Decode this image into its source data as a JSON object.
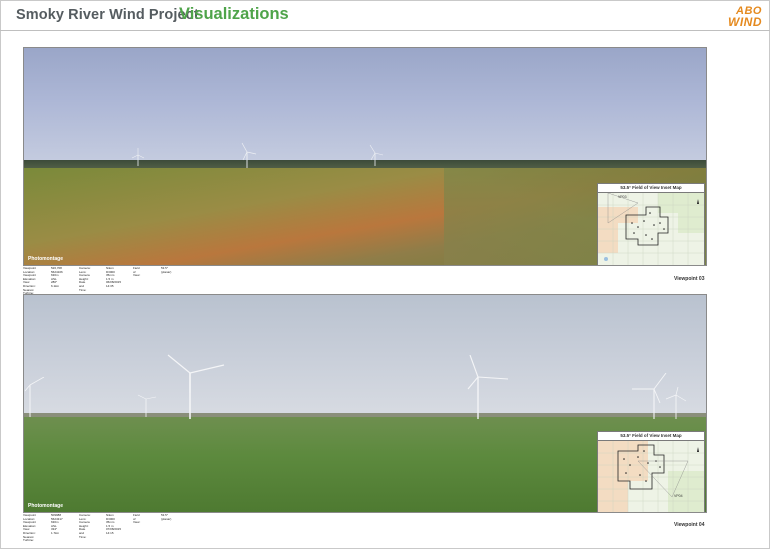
{
  "header": {
    "title": "Smoky River Wind Project",
    "title_accent": "Visualizations",
    "logo_line1": "ABO",
    "logo_line2": "WIND",
    "accent_color": "#4fa44a",
    "logo_color": "#e58a1f"
  },
  "panels": [
    {
      "photo_label": "Photomontage",
      "inset_title": "53.5° Field of View Inset Map",
      "inset_vp_tag": "VP03",
      "viewpoint": "Viewpoint 03",
      "meta": {
        "c1_labels": [
          "Viewpoint Location:",
          "Viewpoint Elevation:",
          "View Direction:",
          "Nearest Turbine:"
        ],
        "c1_values": [
          "526,708 5624106",
          "630m ASL",
          "280°",
          "6.1km"
        ],
        "c2_labels": [
          "Camera:",
          "Lens:",
          "Camera Height:",
          "Date and Time:"
        ],
        "c2_values": [
          "Nikon D3000",
          "35mm",
          "1.5 m",
          "06/08/2015 14:35"
        ],
        "c3_labels": [
          "Field of View:"
        ],
        "c3_values": [
          "53.5° (planar)"
        ]
      }
    },
    {
      "photo_label": "Photomontage",
      "inset_title": "53.5° Field of View Inset Map",
      "inset_vp_tag": "VP04",
      "viewpoint": "Viewpoint 04",
      "meta": {
        "c1_labels": [
          "Viewpoint Location:",
          "Viewpoint Elevation:",
          "View Direction:",
          "Nearest Turbine:"
        ],
        "c1_values": [
          "509988 5624317",
          "630m ASL",
          "334°",
          "1.7km"
        ],
        "c2_labels": [
          "Camera:",
          "Lens:",
          "Camera Height:",
          "Date and Time:"
        ],
        "c2_values": [
          "Nikon D3000",
          "35mm",
          "1.5 m",
          "07/08/2015 14:15"
        ],
        "c3_labels": [
          "Field of View:"
        ],
        "c3_values": [
          "53.5° (planar)"
        ]
      }
    }
  ]
}
